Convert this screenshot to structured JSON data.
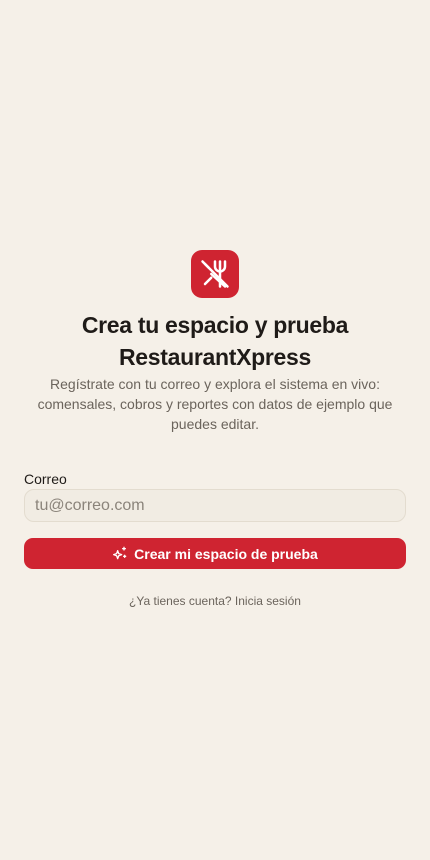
{
  "brand": {
    "logo_icon": "utensils-off-icon",
    "accent_color": "#cf2431"
  },
  "heading": {
    "title": "Crea tu espacio y prueba RestaurantXpress",
    "subtitle": "Regístrate con tu correo y explora el sistema en vivo: comensales, cobros y reportes con datos de ejemplo que puedes editar."
  },
  "form": {
    "email_label": "Correo",
    "email_placeholder": "tu@correo.com",
    "email_value": "",
    "submit_icon": "sparkles-icon",
    "submit_label": "Crear mi espacio de prueba"
  },
  "footer": {
    "login_text": "¿Ya tienes cuenta? Inicia sesión"
  }
}
